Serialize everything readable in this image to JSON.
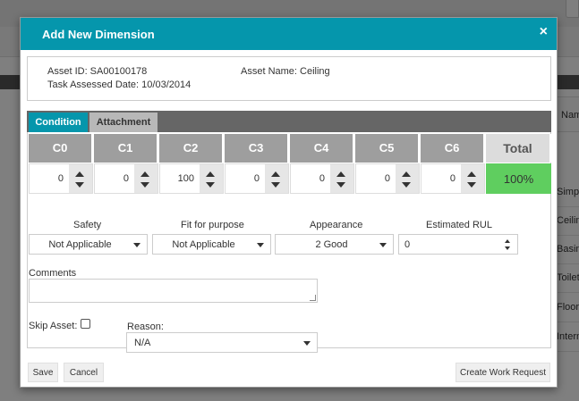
{
  "background": {
    "column_header": "Nam",
    "rows": [
      "Simpl",
      "Ceilin",
      "Basin",
      "Toilet",
      "Floor",
      "Intern"
    ]
  },
  "modal": {
    "title": "Add New Dimension",
    "close_icon": "×",
    "info": {
      "asset_id": "Asset ID: SA00100178",
      "asset_name": "Asset Name: Ceiling",
      "task_date": "Task Assessed Date: 10/03/2014"
    },
    "tabs": [
      {
        "label": "Condition",
        "active": true
      },
      {
        "label": "Attachment",
        "active": false
      }
    ],
    "grid": {
      "headers": [
        "C0",
        "C1",
        "C2",
        "C3",
        "C4",
        "C5",
        "C6"
      ],
      "values": [
        "0",
        "0",
        "100",
        "0",
        "0",
        "0",
        "0"
      ],
      "total_header": "Total",
      "total_value": "100%"
    },
    "fields": {
      "safety": {
        "label": "Safety",
        "value": "Not Applicable"
      },
      "fit_for_purpose": {
        "label": "Fit for purpose",
        "value": "Not Applicable"
      },
      "appearance": {
        "label": "Appearance",
        "value": "2 Good"
      },
      "estimated_rul": {
        "label": "Estimated RUL",
        "value": "0"
      }
    },
    "comments_label": "Comments",
    "skip_asset_label": "Skip Asset:",
    "reason": {
      "label": "Reason:",
      "value": "N/A"
    },
    "buttons": {
      "save": "Save",
      "cancel": "Cancel",
      "create_work_request": "Create Work Request"
    }
  },
  "colors": {
    "header_bg": "#0596ac",
    "tab_active": "#0596ac",
    "total_ok": "#5fce5f",
    "grid_header": "#9e9e9e"
  }
}
